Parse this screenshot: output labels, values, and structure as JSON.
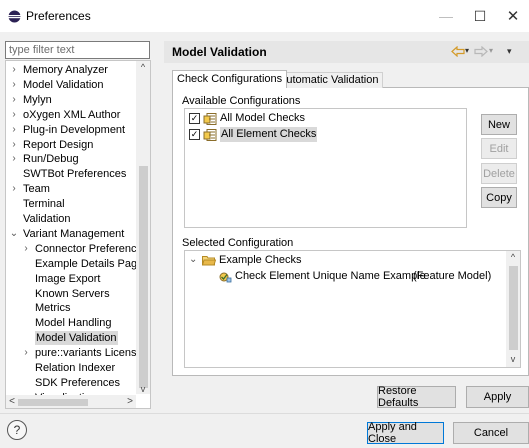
{
  "window": {
    "title": "Preferences",
    "minimize": "—",
    "maximize": "☐",
    "close": "✕"
  },
  "filter": {
    "placeholder": "type filter text",
    "value": ""
  },
  "tree": [
    {
      "label": "Memory Analyzer",
      "chevron": "›",
      "indent": 0,
      "selected": false
    },
    {
      "label": "Model Validation",
      "chevron": "›",
      "indent": 0,
      "selected": false
    },
    {
      "label": "Mylyn",
      "chevron": "›",
      "indent": 0,
      "selected": false
    },
    {
      "label": "oXygen XML Author",
      "chevron": "›",
      "indent": 0,
      "selected": false
    },
    {
      "label": "Plug-in Development",
      "chevron": "›",
      "indent": 0,
      "selected": false
    },
    {
      "label": "Report Design",
      "chevron": "›",
      "indent": 0,
      "selected": false
    },
    {
      "label": "Run/Debug",
      "chevron": "›",
      "indent": 0,
      "selected": false
    },
    {
      "label": "SWTBot Preferences",
      "chevron": "",
      "indent": 0,
      "selected": false
    },
    {
      "label": "Team",
      "chevron": "›",
      "indent": 0,
      "selected": false
    },
    {
      "label": "Terminal",
      "chevron": "",
      "indent": 0,
      "selected": false
    },
    {
      "label": "Validation",
      "chevron": "",
      "indent": 0,
      "selected": false
    },
    {
      "label": "Variant Management",
      "chevron": "⌄",
      "indent": 0,
      "selected": false
    },
    {
      "label": "Connector Preferenc",
      "chevron": "›",
      "indent": 1,
      "selected": false
    },
    {
      "label": "Example Details Pag",
      "chevron": "",
      "indent": 1,
      "selected": false
    },
    {
      "label": "Image Export",
      "chevron": "",
      "indent": 1,
      "selected": false
    },
    {
      "label": "Known Servers",
      "chevron": "",
      "indent": 1,
      "selected": false
    },
    {
      "label": "Metrics",
      "chevron": "",
      "indent": 1,
      "selected": false
    },
    {
      "label": "Model Handling",
      "chevron": "",
      "indent": 1,
      "selected": false
    },
    {
      "label": "Model Validation",
      "chevron": "",
      "indent": 1,
      "selected": true
    },
    {
      "label": "pure::variants Licens",
      "chevron": "›",
      "indent": 1,
      "selected": false
    },
    {
      "label": "Relation Indexer",
      "chevron": "",
      "indent": 1,
      "selected": false
    },
    {
      "label": "SDK Preferences",
      "chevron": "",
      "indent": 1,
      "selected": false
    },
    {
      "label": "Visualization",
      "chevron": "›",
      "indent": 1,
      "selected": false
    }
  ],
  "scroll": {
    "up": "^",
    "down": "v",
    "left": "<",
    "right": ">"
  },
  "page": {
    "title": "Model Validation",
    "back_menu": "▾",
    "fwd_menu": "▾",
    "view_menu": "▾"
  },
  "tabs": [
    {
      "label": "Check Configurations",
      "active": true
    },
    {
      "label": "Automatic Validation",
      "active": false
    }
  ],
  "available": {
    "label": "Available Configurations",
    "items": [
      {
        "label": "All Model Checks",
        "checked": true,
        "selected": false
      },
      {
        "label": "All Element Checks",
        "checked": true,
        "selected": true
      }
    ],
    "checkmark": "✓"
  },
  "side_buttons": {
    "new": "New",
    "edit": "Edit",
    "delete": "Delete",
    "copy": "Copy"
  },
  "selected": {
    "label": "Selected Configuration",
    "group": "Example Checks",
    "group_chevron": "⌄",
    "check": "Check Element Unique Name Example",
    "check_model": "(Feature Model)"
  },
  "buttons": {
    "restore": "Restore Defaults",
    "apply": "Apply",
    "apply_close": "Apply and Close",
    "cancel": "Cancel",
    "help": "?"
  },
  "colors": {
    "accent": "#0078d7",
    "selection": "#d9d9d9",
    "folder": "#e8b84a"
  }
}
